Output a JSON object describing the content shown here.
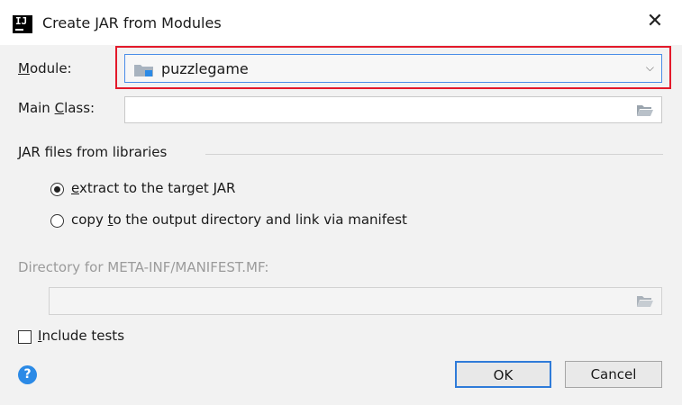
{
  "window": {
    "title": "Create JAR from Modules",
    "close_glyph": "✕",
    "app_icon_text": "IJ"
  },
  "module": {
    "label_prefix": "",
    "label_mnemonic": "M",
    "label_rest": "odule:",
    "selected_value": "puzzlegame",
    "chevron_glyph": "⌵",
    "highlight_color": "#e3192a"
  },
  "main_class": {
    "label_prefix": "Main ",
    "label_mnemonic": "C",
    "label_rest": "lass:",
    "value": ""
  },
  "libraries": {
    "group_label": "JAR files from libraries",
    "options": [
      {
        "prefix": "",
        "mnemonic": "e",
        "rest": "xtract to the target JAR",
        "selected": true
      },
      {
        "prefix": "copy ",
        "mnemonic": "t",
        "rest": "o the output directory and link via manifest",
        "selected": false
      }
    ]
  },
  "manifest": {
    "label": "Directory for META-INF/MANIFEST.MF:",
    "value": ""
  },
  "include_tests": {
    "mnemonic": "I",
    "rest": "nclude tests",
    "checked": false
  },
  "buttons": {
    "help_glyph": "?",
    "ok_label": "OK",
    "cancel_label": "Cancel"
  },
  "colors": {
    "accent": "#2f7bd9",
    "help": "#2b8ae6"
  },
  "icons": [
    "app-icon",
    "close-icon",
    "folder-module-icon",
    "chevron-down-icon",
    "browse-folder-icon",
    "help-icon"
  ]
}
